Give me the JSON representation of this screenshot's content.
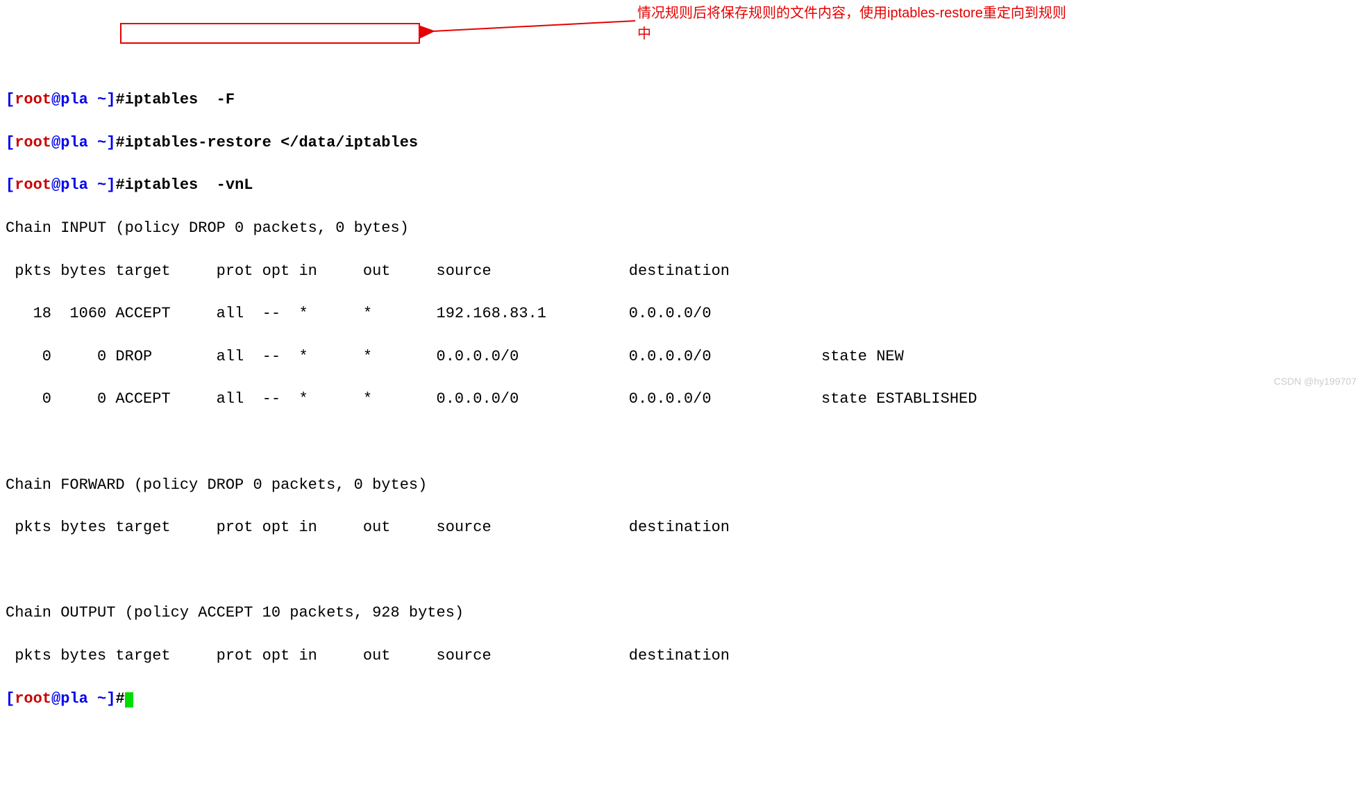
{
  "prompts": [
    {
      "user": "root",
      "host": "pla",
      "path": "~",
      "cmd": "iptables  -F"
    },
    {
      "user": "root",
      "host": "pla",
      "path": "~",
      "cmd": "iptables-restore </data/iptables"
    },
    {
      "user": "root",
      "host": "pla",
      "path": "~",
      "cmd": "iptables  -vnL"
    }
  ],
  "output": {
    "chain_input_header": "Chain INPUT (policy DROP 0 packets, 0 bytes)",
    "col_header": " pkts bytes target     prot opt in     out     source               destination",
    "row1": "   18  1060 ACCEPT     all  --  *      *       192.168.83.1         0.0.0.0/0",
    "row2": "    0     0 DROP       all  --  *      *       0.0.0.0/0            0.0.0.0/0            state NEW",
    "row3": "    0     0 ACCEPT     all  --  *      *       0.0.0.0/0            0.0.0.0/0            state ESTABLISHED",
    "chain_forward_header": "Chain FORWARD (policy DROP 0 packets, 0 bytes)",
    "chain_output_header": "Chain OUTPUT (policy ACCEPT 10 packets, 928 bytes)"
  },
  "final_prompt": {
    "user": "root",
    "host": "pla",
    "path": "~"
  },
  "annotation1": "情况规则后将保存规则的文件内容，使用iptables-restore重定向到规则中",
  "watermark": "CSDN @hy199707"
}
